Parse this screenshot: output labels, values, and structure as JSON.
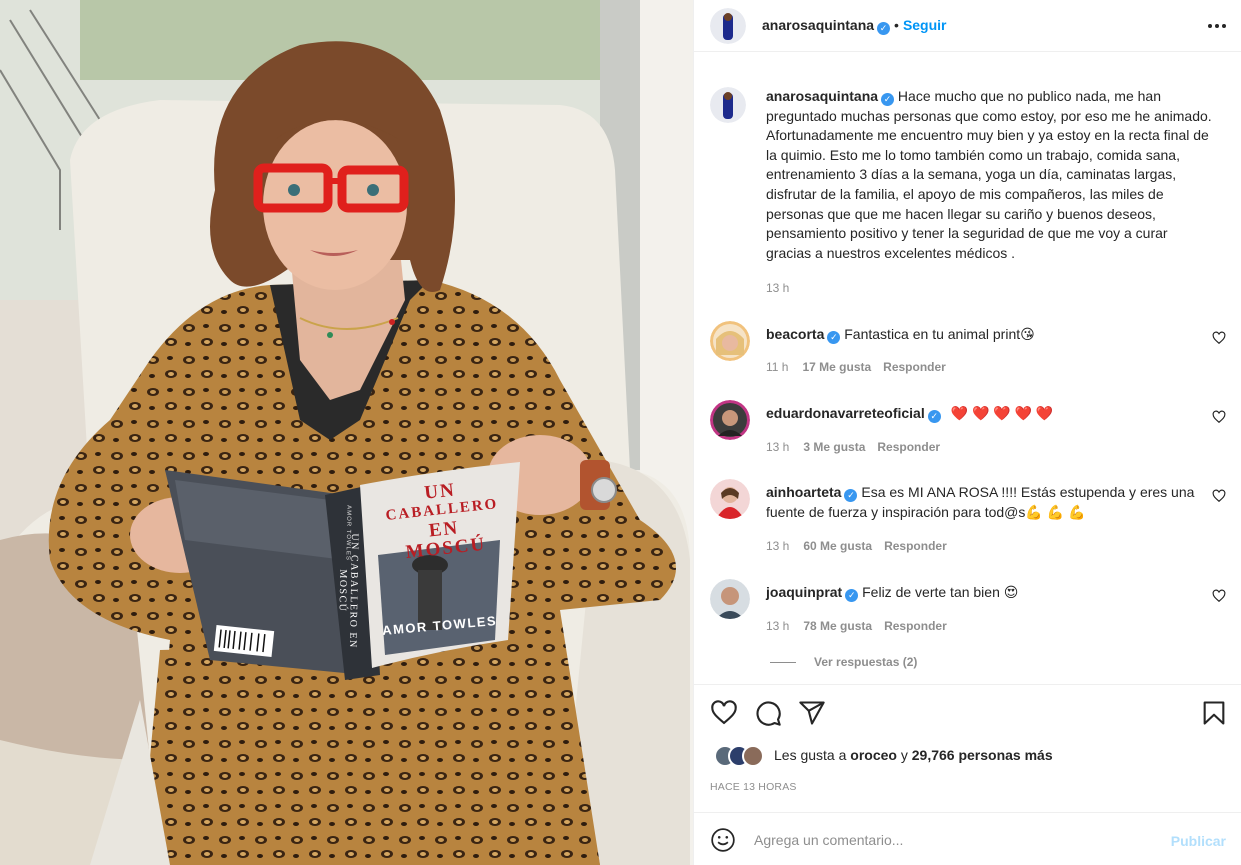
{
  "post": {
    "author": "anarosaquintana",
    "follow_label": "Seguir",
    "more_icon": "more-horizontal-icon",
    "caption": "Hace mucho que no publico nada, me han preguntado muchas personas que como estoy, por eso me he animado. Afortunadamente me encuentro muy bien y ya estoy en la recta final de la quimio. Esto me lo tomo también como un trabajo, comida sana, entrenamiento 3 días a la semana, yoga un día, caminatas largas, disfrutar de la familia, el apoyo de mis compañeros, las miles de personas que que me hacen llegar su cariño y buenos deseos, pensamiento positivo y tener la seguridad de que me voy a curar gracias a nuestros excelentes médicos .",
    "caption_time": "13 h"
  },
  "book": {
    "title_lines": [
      "UN",
      "CABALLERO",
      "EN",
      "MOSCÚ"
    ],
    "author": "AMOR TOWLES",
    "spine_text": "UN CABALLERO EN MOSCÚ",
    "spine_author": "AMOR TOWLES"
  },
  "comments": [
    {
      "user": "beacorta",
      "text": "Fantastica en tu animal print😘",
      "time": "11 h",
      "likes": "17 Me gusta",
      "reply": "Responder"
    },
    {
      "user": "eduardonavarreteoficial",
      "text": "❤️ ❤️ ❤️ ❤️ ❤️",
      "time": "13 h",
      "likes": "3 Me gusta",
      "reply": "Responder"
    },
    {
      "user": "ainhoarteta",
      "text": "Esa es MI ANA ROSA !!!! Estás estupenda y eres una fuente de fuerza y inspiración para tod@s💪 💪 💪",
      "time": "13 h",
      "likes": "60 Me gusta",
      "reply": "Responder"
    },
    {
      "user": "joaquinprat",
      "text": "Feliz de verte tan bien 😍",
      "time": "13 h",
      "likes": "78 Me gusta",
      "reply": "Responder",
      "view_replies": "Ver respuestas (2)"
    }
  ],
  "likes_summary": {
    "prefix": "Les gusta a",
    "first": "oroceo",
    "middle": "y",
    "rest": "29,766 personas más"
  },
  "timestamp": "HACE 13 HORAS",
  "add_comment": {
    "placeholder": "Agrega un comentario...",
    "publish_label": "Publicar"
  },
  "colors": {
    "accent": "#0095f6",
    "verified": "#3897f0",
    "publish_disabled": "#b2dffc",
    "muted": "#8e8e8e",
    "glasses": "#e0201c"
  }
}
